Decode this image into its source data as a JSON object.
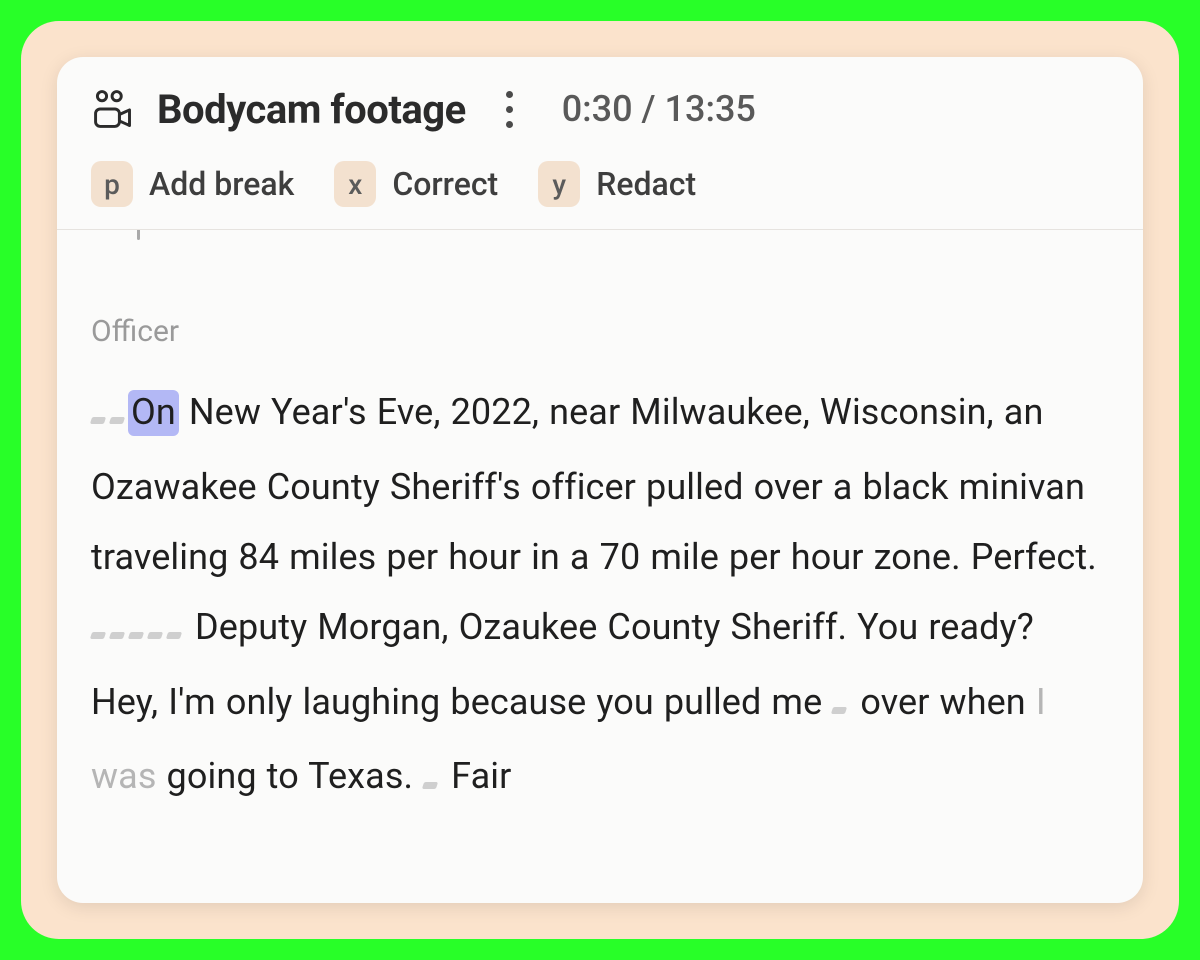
{
  "header": {
    "title": "Bodycam footage",
    "time_current": "0:30",
    "time_total": "13:35",
    "time_display": "0:30 / 13:35"
  },
  "toolbar": {
    "add_break": {
      "key": "p",
      "label": "Add break"
    },
    "correct": {
      "key": "x",
      "label": "Correct"
    },
    "redact": {
      "key": "y",
      "label": "Redact"
    }
  },
  "transcript": {
    "speaker": "Officer",
    "highlight_word": "On",
    "seg1": " New Year's Eve, 2022, near Milwaukee, Wisconsin, an Ozawakee County Sheriff's officer pulled over a black minivan traveling 84 miles per hour in a 70 mile per hour zone. Perfect. ",
    "seg2": " Deputy Morgan, Ozaukee County Sheriff. You ready? Hey, I'm only laughing because you pulled me ",
    "seg3": " over when ",
    "faded": "I was",
    "seg4": " going to Texas. ",
    "seg5": " Fair"
  }
}
